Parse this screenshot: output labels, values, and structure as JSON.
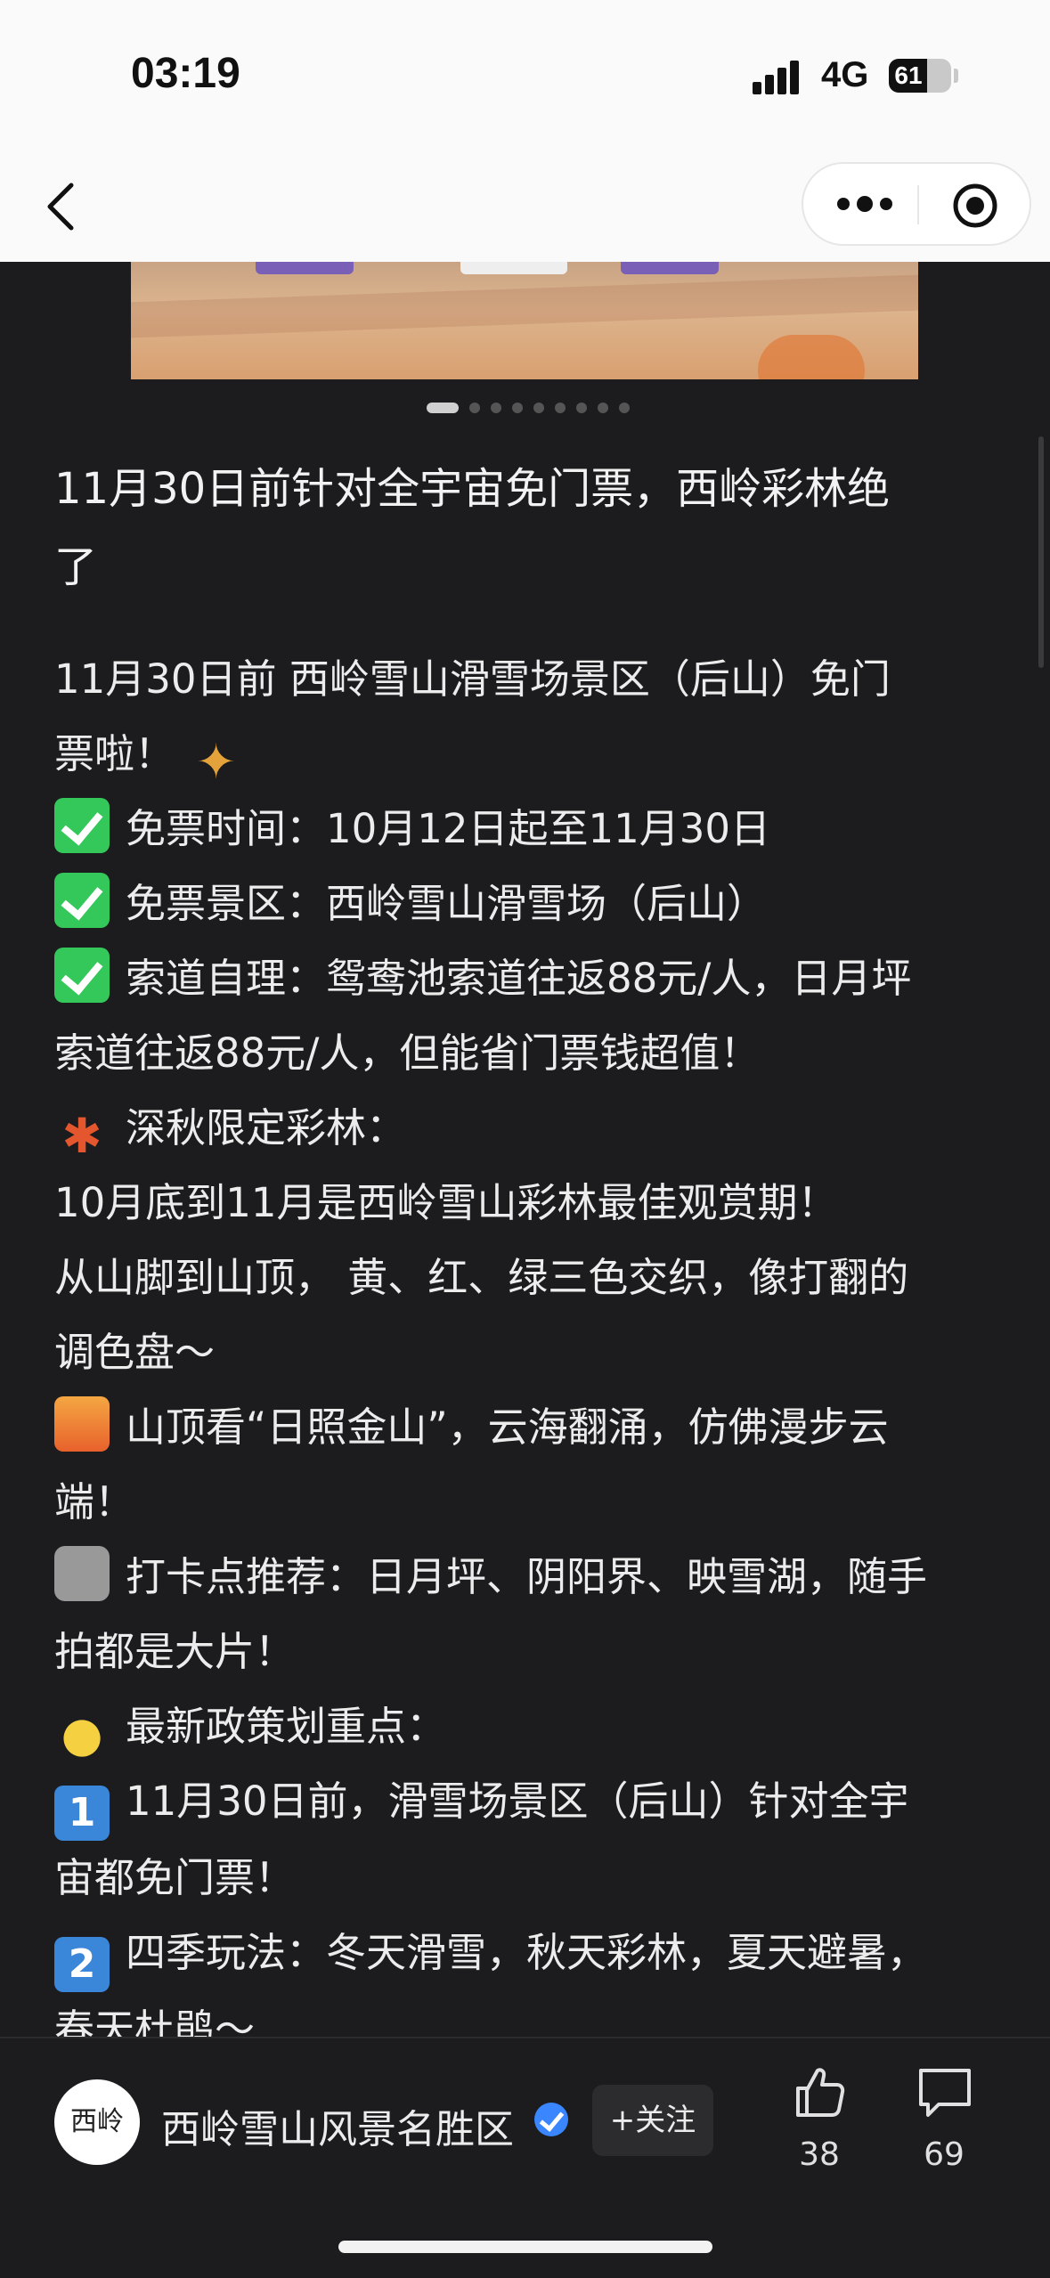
{
  "status": {
    "time": "03:19",
    "network": "4G",
    "battery": "61",
    "battery_level": 0.61
  },
  "nav": {
    "back_icon": "chevron-left-icon",
    "more_icon": "more-dots-icon",
    "close_icon": "target-close-icon"
  },
  "carousel": {
    "total": 9,
    "active": 0
  },
  "article": {
    "title_lines": [
      "11月30日前针对全宇宙免门票，西岭彩林绝",
      "了"
    ],
    "lines": [
      {
        "emoji": "",
        "text": "11月30日前 西岭雪山滑雪场景区（后山）免门"
      },
      {
        "emoji": "",
        "text": "票啦！",
        "trail": "party-popper-icon"
      },
      {
        "emoji": "check",
        "text": "免票时间：10月12日起至11月30日"
      },
      {
        "emoji": "check",
        "text": "免票景区：西岭雪山滑雪场（后山）"
      },
      {
        "emoji": "check",
        "text": "索道自理：鸳鸯池索道往返88元/人，日月坪"
      },
      {
        "emoji": "",
        "text": "索道往返88元/人，但能省门票钱超值！"
      },
      {
        "emoji": "leaf",
        "text": "深秋限定彩林："
      },
      {
        "emoji": "",
        "text": "10月底到11月是西岭雪山彩林最佳观赏期！"
      },
      {
        "emoji": "",
        "text": "从山脚到山顶， 黄、红、绿三色交织，像打翻的"
      },
      {
        "emoji": "",
        "text": "调色盘～"
      },
      {
        "emoji": "sunrise",
        "text": "山顶看“日照金山”，云海翻涌，仿佛漫步云"
      },
      {
        "emoji": "",
        "text": "端！"
      },
      {
        "emoji": "camera",
        "text": "打卡点推荐：日月坪、阴阳界、映雪湖，随手"
      },
      {
        "emoji": "",
        "text": "拍都是大片！"
      },
      {
        "emoji": "bulb",
        "text": "最新政策划重点："
      },
      {
        "emoji": "num1",
        "text": "11月30日前，滑雪场景区（后山）针对全宇"
      },
      {
        "emoji": "",
        "text": "宙都免门票！"
      },
      {
        "emoji": "num2",
        "text": "四季玩法：冬天滑雪，秋天彩林，夏天避暑，"
      },
      {
        "emoji": "",
        "text": "春天杜鹃～"
      }
    ]
  },
  "footer": {
    "avatar_text": "西岭",
    "account_name": "西岭雪山风景名胜区",
    "follow_label": "+关注",
    "like_count": "38",
    "comment_count": "69",
    "like_icon": "thumbs-up-icon",
    "comment_icon": "comment-bubble-icon"
  },
  "colors": {
    "background": "#1c1c1e",
    "text": "#ececec",
    "verified": "#3a86ff",
    "check": "#34c759"
  }
}
